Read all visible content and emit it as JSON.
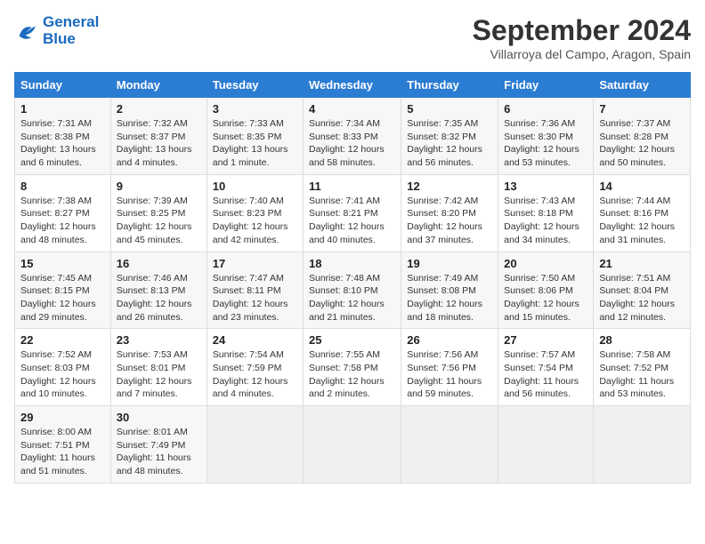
{
  "header": {
    "logo_line1": "General",
    "logo_line2": "Blue",
    "month": "September 2024",
    "location": "Villarroya del Campo, Aragon, Spain"
  },
  "weekdays": [
    "Sunday",
    "Monday",
    "Tuesday",
    "Wednesday",
    "Thursday",
    "Friday",
    "Saturday"
  ],
  "weeks": [
    [
      {
        "day": "1",
        "info": "Sunrise: 7:31 AM\nSunset: 8:38 PM\nDaylight: 13 hours\nand 6 minutes."
      },
      {
        "day": "2",
        "info": "Sunrise: 7:32 AM\nSunset: 8:37 PM\nDaylight: 13 hours\nand 4 minutes."
      },
      {
        "day": "3",
        "info": "Sunrise: 7:33 AM\nSunset: 8:35 PM\nDaylight: 13 hours\nand 1 minute."
      },
      {
        "day": "4",
        "info": "Sunrise: 7:34 AM\nSunset: 8:33 PM\nDaylight: 12 hours\nand 58 minutes."
      },
      {
        "day": "5",
        "info": "Sunrise: 7:35 AM\nSunset: 8:32 PM\nDaylight: 12 hours\nand 56 minutes."
      },
      {
        "day": "6",
        "info": "Sunrise: 7:36 AM\nSunset: 8:30 PM\nDaylight: 12 hours\nand 53 minutes."
      },
      {
        "day": "7",
        "info": "Sunrise: 7:37 AM\nSunset: 8:28 PM\nDaylight: 12 hours\nand 50 minutes."
      }
    ],
    [
      {
        "day": "8",
        "info": "Sunrise: 7:38 AM\nSunset: 8:27 PM\nDaylight: 12 hours\nand 48 minutes."
      },
      {
        "day": "9",
        "info": "Sunrise: 7:39 AM\nSunset: 8:25 PM\nDaylight: 12 hours\nand 45 minutes."
      },
      {
        "day": "10",
        "info": "Sunrise: 7:40 AM\nSunset: 8:23 PM\nDaylight: 12 hours\nand 42 minutes."
      },
      {
        "day": "11",
        "info": "Sunrise: 7:41 AM\nSunset: 8:21 PM\nDaylight: 12 hours\nand 40 minutes."
      },
      {
        "day": "12",
        "info": "Sunrise: 7:42 AM\nSunset: 8:20 PM\nDaylight: 12 hours\nand 37 minutes."
      },
      {
        "day": "13",
        "info": "Sunrise: 7:43 AM\nSunset: 8:18 PM\nDaylight: 12 hours\nand 34 minutes."
      },
      {
        "day": "14",
        "info": "Sunrise: 7:44 AM\nSunset: 8:16 PM\nDaylight: 12 hours\nand 31 minutes."
      }
    ],
    [
      {
        "day": "15",
        "info": "Sunrise: 7:45 AM\nSunset: 8:15 PM\nDaylight: 12 hours\nand 29 minutes."
      },
      {
        "day": "16",
        "info": "Sunrise: 7:46 AM\nSunset: 8:13 PM\nDaylight: 12 hours\nand 26 minutes."
      },
      {
        "day": "17",
        "info": "Sunrise: 7:47 AM\nSunset: 8:11 PM\nDaylight: 12 hours\nand 23 minutes."
      },
      {
        "day": "18",
        "info": "Sunrise: 7:48 AM\nSunset: 8:10 PM\nDaylight: 12 hours\nand 21 minutes."
      },
      {
        "day": "19",
        "info": "Sunrise: 7:49 AM\nSunset: 8:08 PM\nDaylight: 12 hours\nand 18 minutes."
      },
      {
        "day": "20",
        "info": "Sunrise: 7:50 AM\nSunset: 8:06 PM\nDaylight: 12 hours\nand 15 minutes."
      },
      {
        "day": "21",
        "info": "Sunrise: 7:51 AM\nSunset: 8:04 PM\nDaylight: 12 hours\nand 12 minutes."
      }
    ],
    [
      {
        "day": "22",
        "info": "Sunrise: 7:52 AM\nSunset: 8:03 PM\nDaylight: 12 hours\nand 10 minutes."
      },
      {
        "day": "23",
        "info": "Sunrise: 7:53 AM\nSunset: 8:01 PM\nDaylight: 12 hours\nand 7 minutes."
      },
      {
        "day": "24",
        "info": "Sunrise: 7:54 AM\nSunset: 7:59 PM\nDaylight: 12 hours\nand 4 minutes."
      },
      {
        "day": "25",
        "info": "Sunrise: 7:55 AM\nSunset: 7:58 PM\nDaylight: 12 hours\nand 2 minutes."
      },
      {
        "day": "26",
        "info": "Sunrise: 7:56 AM\nSunset: 7:56 PM\nDaylight: 11 hours\nand 59 minutes."
      },
      {
        "day": "27",
        "info": "Sunrise: 7:57 AM\nSunset: 7:54 PM\nDaylight: 11 hours\nand 56 minutes."
      },
      {
        "day": "28",
        "info": "Sunrise: 7:58 AM\nSunset: 7:52 PM\nDaylight: 11 hours\nand 53 minutes."
      }
    ],
    [
      {
        "day": "29",
        "info": "Sunrise: 8:00 AM\nSunset: 7:51 PM\nDaylight: 11 hours\nand 51 minutes."
      },
      {
        "day": "30",
        "info": "Sunrise: 8:01 AM\nSunset: 7:49 PM\nDaylight: 11 hours\nand 48 minutes."
      },
      {
        "day": "",
        "info": ""
      },
      {
        "day": "",
        "info": ""
      },
      {
        "day": "",
        "info": ""
      },
      {
        "day": "",
        "info": ""
      },
      {
        "day": "",
        "info": ""
      }
    ]
  ]
}
